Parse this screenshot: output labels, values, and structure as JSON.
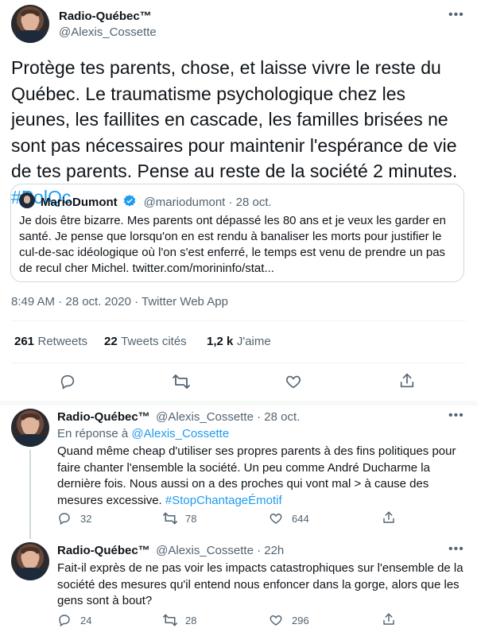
{
  "tweet": {
    "author_name": "Radio-Québec™",
    "author_handle": "@Alexis_Cossette",
    "text_before": "Protège tes parents, chose, et laisse vivre le reste du Québec. Le traumatisme psychologique chez les jeunes, les faillites en cascade, les familles brisées ne sont pas nécessaires pour maintenir l'espérance de vie de tes parents. Pense au reste de la société 2 minutes. ",
    "hashtag": "#PolQc",
    "timestamp": "8:49 AM · 28 oct. 2020 · Twitter Web App",
    "stats": {
      "retweets_num": "261",
      "retweets_lbl": "Retweets",
      "quotes_num": "22",
      "quotes_lbl": "Tweets cités",
      "likes_num": "1,2 k",
      "likes_lbl": "J'aime"
    }
  },
  "quoted": {
    "name": "MarioDumont",
    "handle_date": "@mariodumont · 28 oct.",
    "text": "Je dois être bizarre.  Mes parents ont dépassé les 80 ans et je veux les garder en santé. Je pense que lorsqu'on en est rendu à banaliser les morts pour justifier le cul-de-sac idéologique où l'on s'est enferré, le temps est venu de prendre un pas de recul cher Michel. twitter.com/morininfo/stat..."
  },
  "replies": [
    {
      "name": "Radio-Québec™",
      "handle_date": "@Alexis_Cossette · 28 oct.",
      "reply_to_prefix": "En réponse à ",
      "reply_to_handle": "@Alexis_Cossette",
      "text": "Quand même cheap d'utiliser ses propres parents à des fins politiques pour faire chanter l'ensemble la société. Un peu comme André Ducharme la dernière fois. Nous aussi on a des proches qui vont mal > à cause des mesures excessive. ",
      "hashtag": "#StopChantageÉmotif",
      "replies_count": "32",
      "retweets_count": "78",
      "likes_count": "644"
    },
    {
      "name": "Radio-Québec™",
      "handle_date": "@Alexis_Cossette · 22h",
      "text": "Fait-il exprès de ne pas voir les impacts catastrophiques sur l'ensemble de la société des mesures qu'il entend nous enfoncer dans la gorge, alors que les gens sont à bout?",
      "replies_count": "24",
      "retweets_count": "28",
      "likes_count": "296"
    }
  ],
  "colors": {
    "link": "#1d9bf0",
    "muted": "#536471",
    "border": "#cfd9de"
  }
}
